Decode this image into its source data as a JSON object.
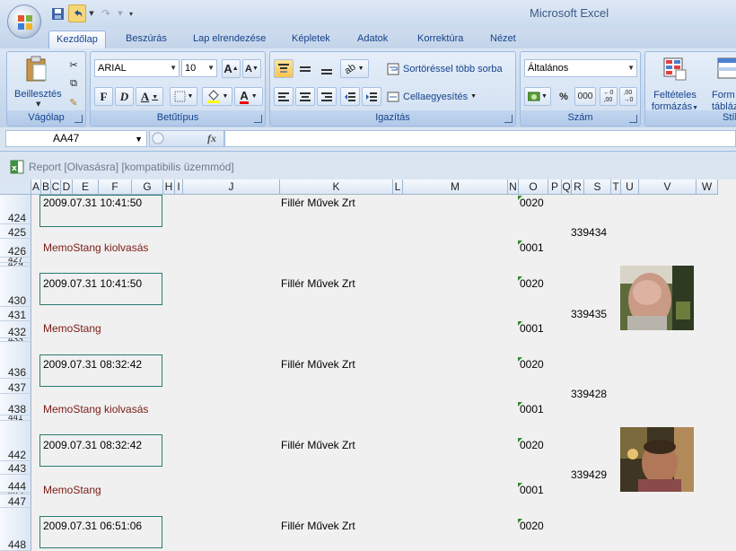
{
  "app": {
    "title": "Microsoft Excel"
  },
  "tabs": [
    "Kezdőlap",
    "Beszúrás",
    "Lap elrendezése",
    "Képletek",
    "Adatok",
    "Korrektúra",
    "Nézet"
  ],
  "ribbon": {
    "clipboard": {
      "label": "Vágólap",
      "paste_label": "Beillesztés"
    },
    "font": {
      "label": "Betűtípus",
      "name": "ARIAL",
      "size": "10",
      "bold": "F",
      "italic": "D",
      "underline": "A",
      "color_label": "A"
    },
    "alignment": {
      "label": "Igazítás",
      "wrap_label": "Sortöréssel több sorba",
      "merge_label": "Cellaegyesítés"
    },
    "number": {
      "label": "Szám",
      "format": "Általános",
      "percent": "%",
      "thousands": "000"
    },
    "styles": {
      "cond_label_1": "Feltételes",
      "cond_label_2": "formázás",
      "table_label_1": "Form",
      "table_label_2": "táblázat",
      "label": "Stíl"
    }
  },
  "formula_bar": {
    "name_box": "AA47",
    "fx": "fx",
    "value": ""
  },
  "workbook": {
    "title": "Report  [Olvasásra]  [kompatibilis üzemmód]"
  },
  "columns": [
    "A",
    "B",
    "C",
    "D",
    "E",
    "F",
    "G",
    "H",
    "I",
    "J",
    "K",
    "L",
    "M",
    "N",
    "O",
    "P",
    "Q",
    "R",
    "S",
    "T",
    "U",
    "V",
    "W"
  ],
  "rows": [
    {
      "num": "424"
    },
    {
      "num": "425"
    },
    {
      "num": "426"
    },
    {
      "num": "427"
    },
    {
      "num": "429"
    },
    {
      "num": "430"
    },
    {
      "num": "431"
    },
    {
      "num": "432"
    },
    {
      "num": "433"
    },
    {
      "num": "436"
    },
    {
      "num": "437"
    },
    {
      "num": "438"
    },
    {
      "num": "441"
    },
    {
      "num": "442"
    },
    {
      "num": "443"
    },
    {
      "num": "444"
    },
    {
      "num": "445"
    },
    {
      "num": "447"
    },
    {
      "num": "448"
    }
  ],
  "records": [
    {
      "datetime": "2009.07.31  10:41:50",
      "company": "Fillér Művek Zrt",
      "code": "0020"
    },
    {
      "id": "339434"
    },
    {
      "label": "MemoStang kiolvasás",
      "code": "0001"
    },
    {
      "datetime": "2009.07.31  10:41:50",
      "company": "Fillér Művek Zrt",
      "code": "0020"
    },
    {
      "id": "339435"
    },
    {
      "label": "MemoStang",
      "code": "0001"
    },
    {
      "datetime": "2009.07.31  08:32:42",
      "company": "Fillér Művek Zrt",
      "code": "0020"
    },
    {
      "id": "339428"
    },
    {
      "label": "MemoStang kiolvasás",
      "code": "0001"
    },
    {
      "datetime": "2009.07.31  08:32:42",
      "company": "Fillér Művek Zrt",
      "code": "0020"
    },
    {
      "id": "339429"
    },
    {
      "label": "MemoStang",
      "code": "0001"
    },
    {
      "datetime": "2009.07.31  06:51:06",
      "company": "Fillér Művek Zrt",
      "code": "0020"
    }
  ]
}
